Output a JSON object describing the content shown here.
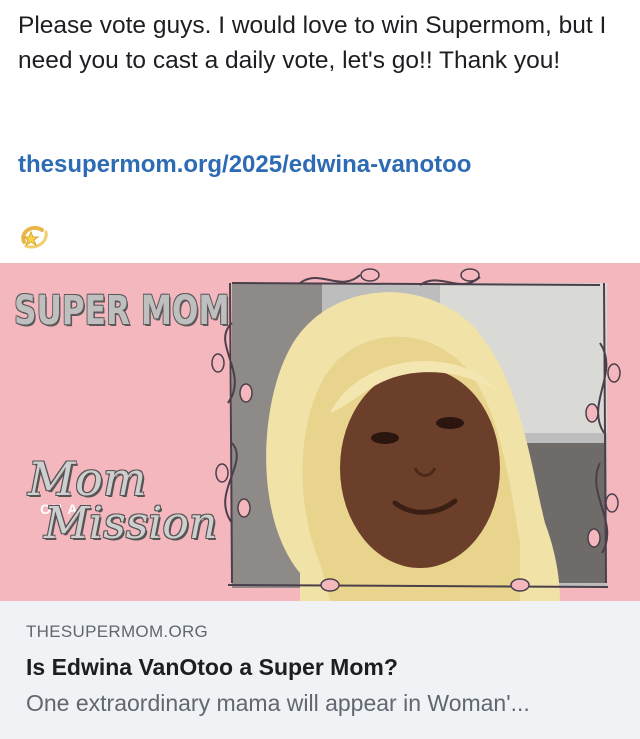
{
  "post": {
    "text": "Please vote guys. I would love to win Supermom, but I need you to cast a daily vote, let's go!! Thank you!",
    "link": "thesupermom.org/2025/edwina-vanotoo",
    "emoji": "dizzy-star-emoji"
  },
  "preview": {
    "badge_title": "SUPER MOM",
    "script_word_1": "Mom",
    "small_words": "ON A",
    "script_word_2": "Mission",
    "colors": {
      "background": "#f4b7be",
      "hair": "#f3e6b0",
      "skin": "#6b3f2a"
    }
  },
  "card": {
    "domain": "THESUPERMOM.ORG",
    "title": "Is Edwina VanOtoo a Super Mom?",
    "description": "One extraordinary mama will appear in Woman'..."
  }
}
